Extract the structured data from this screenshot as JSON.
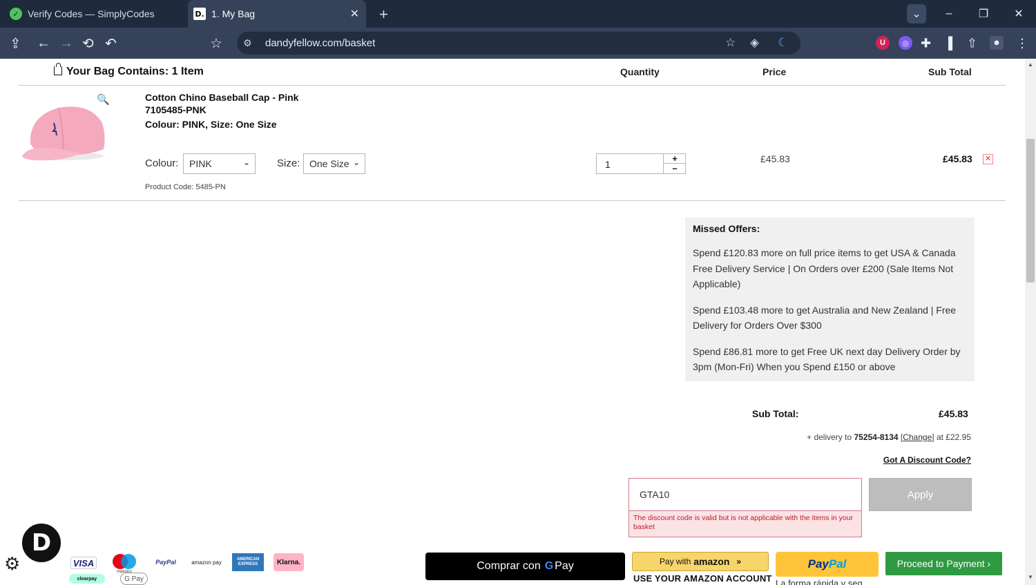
{
  "browser": {
    "tabs": [
      {
        "title": "Verify Codes — SimplyCodes",
        "favicon": "simplycodes-icon"
      },
      {
        "title": "1. My Bag",
        "favicon": "dandyfellow-d-icon"
      }
    ],
    "url": "dandyfellow.com/basket"
  },
  "bag": {
    "heading": "Your Bag Contains: 1 Item",
    "columns": {
      "quantity": "Quantity",
      "price": "Price",
      "subtotal": "Sub Total"
    }
  },
  "item": {
    "name": "Cotton Chino Baseball Cap - Pink",
    "sku": "7105485-PNK",
    "variant": "Colour: PINK, Size: One Size",
    "colour_label": "Colour:",
    "colour_value": "PINK",
    "size_label": "Size:",
    "size_value": "One Size",
    "product_code": "Product Code: 5485-PN",
    "quantity": "1",
    "plus": "+",
    "minus": "–",
    "price": "£45.83",
    "subtotal": "£45.83",
    "remove": "✕"
  },
  "offers": {
    "title": "Missed Offers:",
    "items": [
      "Spend £120.83 more on full price items to get USA & Canada Free Delivery Service | On Orders over £200 (Sale Items Not Applicable)",
      "Spend £103.48 more to get Australia and New Zealand | Free Delivery for Orders Over $300",
      "Spend £86.81 more to get Free UK next day Delivery Order by 3pm (Mon-Fri) When you Spend £150 or above"
    ]
  },
  "totals": {
    "subtotal_label": "Sub Total:",
    "subtotal_value": "£45.83",
    "delivery_prefix": "+ delivery to ",
    "delivery_zip": "75254-8134",
    "delivery_change": "Change",
    "delivery_suffix": " at £22.95",
    "discount_link": "Got A Discount Code?"
  },
  "discount": {
    "code": "GTA10",
    "error": "The discount code is valid but is not applicable with the items in your basket",
    "apply": "Apply"
  },
  "payment": {
    "badge_letter": "D",
    "logos": [
      "VISA",
      "maestro",
      "PayPal",
      "amazon pay",
      "AMERICAN EXPRESS",
      "Klarna.",
      "clearpay",
      "G Pay"
    ],
    "gpay_prefix": "Comprar con",
    "gpay_g": "G",
    "gpay_suffix": "Pay",
    "amazon_prefix": "Pay with",
    "amazon_brand": "amazon",
    "amazon_sub": "USE YOUR AMAZON ACCOUNT",
    "paypal_a": "Pay",
    "paypal_b": "Pal",
    "paypal_sub": "La forma rápida y seg",
    "proceed": "Proceed to Payment ›"
  },
  "colors": {
    "accent_green": "#2f9a42",
    "paypal_yellow": "#ffc439",
    "amazon_yellow": "#f7d56a",
    "error_red": "#c0192b",
    "chrome_dark": "#1f2a3d"
  }
}
